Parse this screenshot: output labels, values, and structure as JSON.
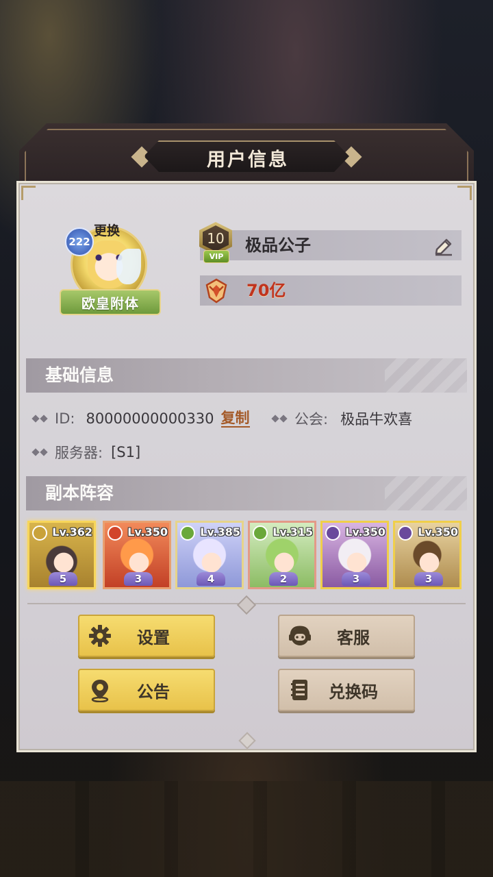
{
  "dialog": {
    "title": "用户信息"
  },
  "profile": {
    "avatar_level": "222",
    "change_label": "更换",
    "avatar_title": "欧皇附体",
    "vip_level": "10",
    "vip_tag": "VIP",
    "name": "极品公子",
    "power": "70亿"
  },
  "basic_info": {
    "section_title": "基础信息",
    "id_label": "ID:",
    "id_value": "80000000000330",
    "copy_label": "复制",
    "guild_label": "公会:",
    "guild_value": "极品牛欢喜",
    "server_label": "服务器:",
    "server_value": "[S1]"
  },
  "lineup": {
    "section_title": "副本阵容",
    "heroes": [
      {
        "level": "Lv.362",
        "stars": "5",
        "element": "light"
      },
      {
        "level": "Lv.350",
        "stars": "3",
        "element": "fire"
      },
      {
        "level": "Lv.385",
        "stars": "4",
        "element": "nature"
      },
      {
        "level": "Lv.315",
        "stars": "2",
        "element": "nature"
      },
      {
        "level": "Lv.350",
        "stars": "3",
        "element": "dark"
      },
      {
        "level": "Lv.350",
        "stars": "3",
        "element": "dark"
      }
    ]
  },
  "buttons": {
    "settings": "设置",
    "support": "客服",
    "announcement": "公告",
    "redeem_code": "兑换码"
  },
  "colors": {
    "power_text": "#c0341e",
    "button_primary": "#f0d05a",
    "button_secondary": "#dcc9b4"
  }
}
